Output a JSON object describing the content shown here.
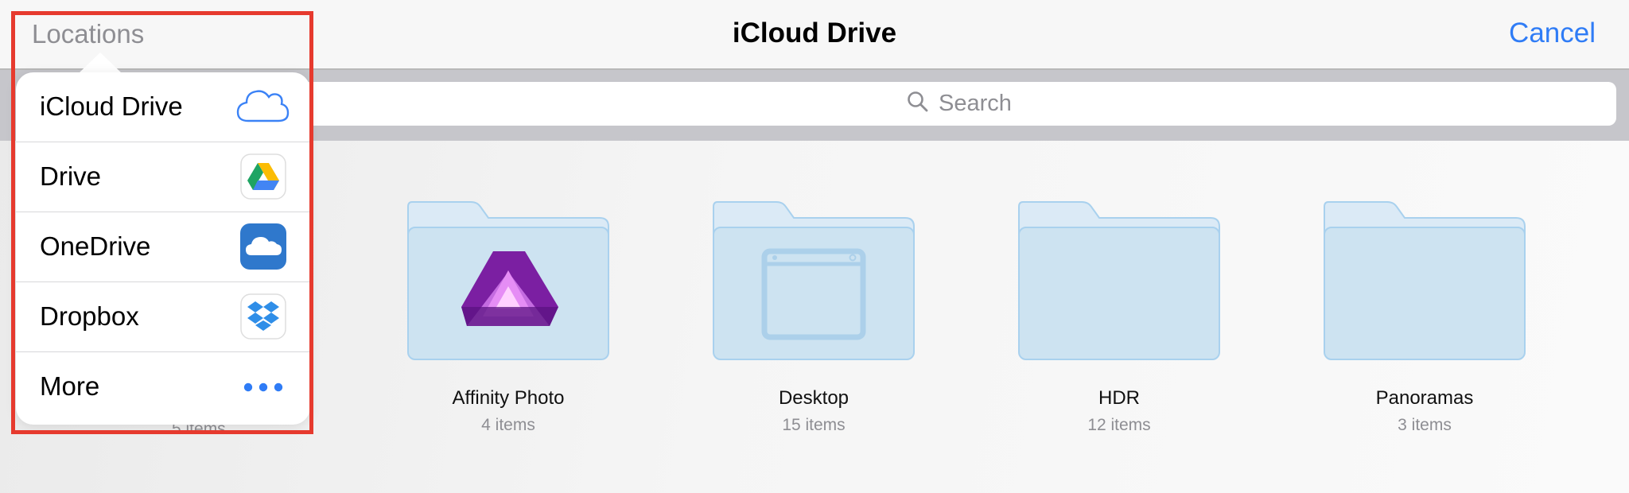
{
  "navbar": {
    "title": "iCloud Drive",
    "left_label": "Locations",
    "right_label": "Cancel"
  },
  "search": {
    "placeholder": "Search"
  },
  "items": [
    {
      "name": "Affinity Photo",
      "count": "4 items",
      "icon": "affinity-photo-icon"
    },
    {
      "name": "Desktop",
      "count": "15 items",
      "icon": "desktop-window-icon"
    },
    {
      "name": "HDR",
      "count": "12 items",
      "icon": "folder-icon"
    },
    {
      "name": "Panoramas",
      "count": "3 items",
      "icon": "folder-icon"
    }
  ],
  "partially_hidden_item": {
    "count": "5 items"
  },
  "locations_popover": {
    "items": [
      {
        "label": "iCloud Drive",
        "icon": "icloud-icon"
      },
      {
        "label": "Drive",
        "icon": "google-drive-icon"
      },
      {
        "label": "OneDrive",
        "icon": "onedrive-icon"
      },
      {
        "label": "Dropbox",
        "icon": "dropbox-icon"
      },
      {
        "label": "More",
        "icon": "more-ellipsis-icon"
      }
    ]
  },
  "colors": {
    "accent": "#2f7cf6",
    "folder_fill": "#cfe4f2",
    "folder_stroke": "#a9d1ee",
    "highlight_border": "#e63a2e"
  }
}
